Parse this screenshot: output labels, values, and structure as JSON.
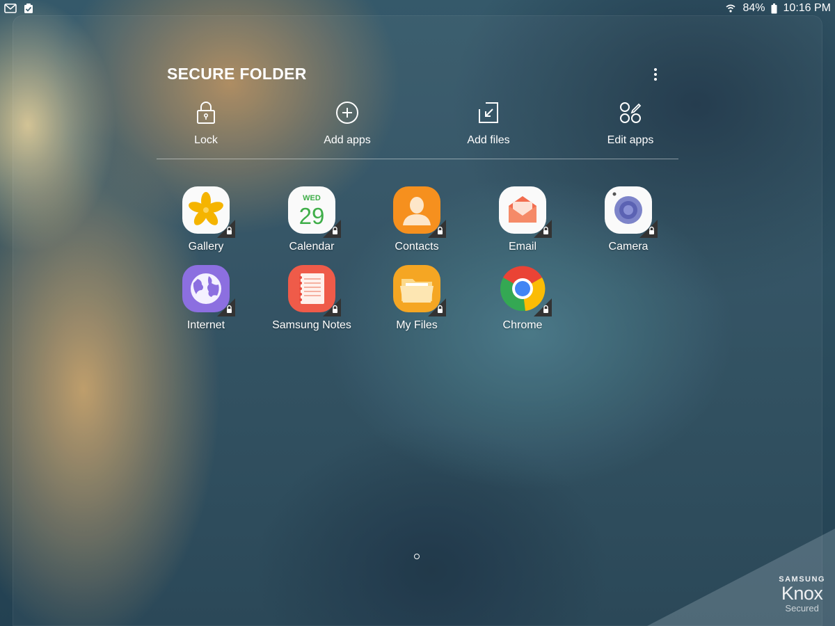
{
  "status_bar": {
    "left_icons": [
      "gmail-icon",
      "clipboard-check-icon"
    ],
    "battery": "84%",
    "time": "10:16 PM",
    "icons": [
      "wifi-icon",
      "battery-icon"
    ]
  },
  "folder": {
    "title": "SECURE FOLDER"
  },
  "actions": [
    {
      "label": "Lock",
      "icon": "lock-icon"
    },
    {
      "label": "Add apps",
      "icon": "plus-circle-icon"
    },
    {
      "label": "Add files",
      "icon": "add-files-icon"
    },
    {
      "label": "Edit apps",
      "icon": "edit-apps-icon"
    }
  ],
  "apps": [
    {
      "label": "Gallery",
      "icon": "gallery-icon"
    },
    {
      "label": "Calendar",
      "icon": "calendar-icon",
      "day": "WED",
      "date": "29"
    },
    {
      "label": "Contacts",
      "icon": "contacts-icon"
    },
    {
      "label": "Email",
      "icon": "email-icon"
    },
    {
      "label": "Camera",
      "icon": "camera-icon"
    },
    {
      "label": "Internet",
      "icon": "internet-icon"
    },
    {
      "label": "Samsung Notes",
      "icon": "notes-icon"
    },
    {
      "label": "My Files",
      "icon": "folder-icon"
    },
    {
      "label": "Chrome",
      "icon": "chrome-icon"
    }
  ],
  "watermark": {
    "brand": "SAMSUNG",
    "name": "Knox",
    "sub": "Secured"
  }
}
